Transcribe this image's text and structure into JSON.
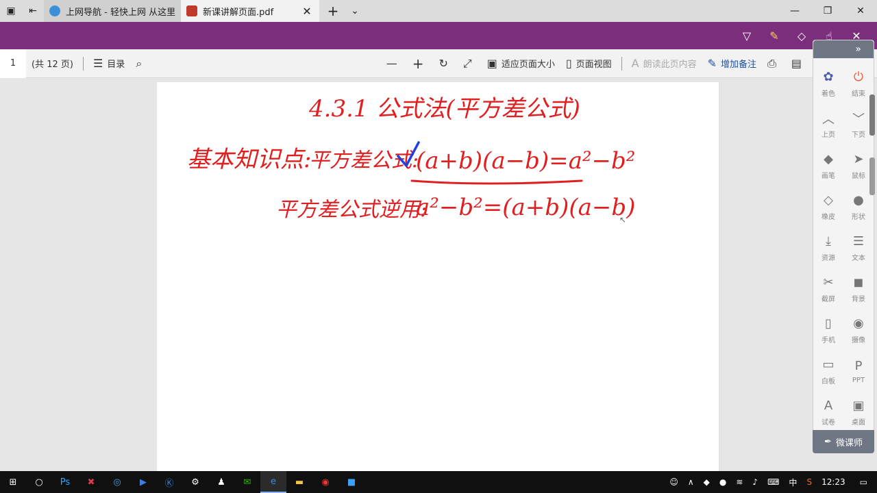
{
  "browser": {
    "tabs": [
      {
        "title": "上网导航 - 轻快上网 从这里",
        "active": false
      },
      {
        "title": "新课讲解页面.pdf",
        "active": true
      }
    ],
    "new_tab": "+",
    "tab_list": "⌄"
  },
  "ink_toolbar": {
    "tools": [
      "ballpoint-pen-icon",
      "highlighter-icon",
      "eraser-icon",
      "touch-write-icon",
      "close-icon"
    ]
  },
  "pdf_toolbar": {
    "page_number": "1",
    "page_total": "(共 12 页)",
    "contents_label": "目录",
    "fit_page_label": "适应页面大小",
    "page_view_label": "页面视图",
    "read_aloud_label": "朗读此页内容",
    "add_notes_label": "增加备注"
  },
  "page_content": {
    "title": "4.3.1 公式法(平方差公式)",
    "line1_label": "基本知识点:",
    "line1_sub": "平方差公式:",
    "line1_formula": "(a+b)(a−b)=a²−b²",
    "line2_label": "平方差公式逆用:",
    "line2_formula": "a²−b²=(a+b)(a−b)",
    "ink_color": "#e02020",
    "check_color": "#2040e0"
  },
  "side_panel": {
    "items": [
      {
        "icon": "palette-icon",
        "label": "着色"
      },
      {
        "icon": "power-icon",
        "label": "结束"
      },
      {
        "icon": "chevron-up-icon",
        "label": "上页"
      },
      {
        "icon": "chevron-down-icon",
        "label": "下页"
      },
      {
        "icon": "pen-icon",
        "label": "画笔"
      },
      {
        "icon": "mouse-pointer-icon",
        "label": "鼠标"
      },
      {
        "icon": "eraser-icon",
        "label": "橡皮"
      },
      {
        "icon": "shape-icon",
        "label": "形状"
      },
      {
        "icon": "download-icon",
        "label": "资源"
      },
      {
        "icon": "document-icon",
        "label": "文本"
      },
      {
        "icon": "scissors-icon",
        "label": "截屏"
      },
      {
        "icon": "layers-icon",
        "label": "背景"
      },
      {
        "icon": "phone-icon",
        "label": "手机"
      },
      {
        "icon": "camera-icon",
        "label": "摄像"
      },
      {
        "icon": "whiteboard-icon",
        "label": "白板"
      },
      {
        "icon": "ppt-icon",
        "label": "PPT"
      },
      {
        "icon": "quiz-icon",
        "label": "试卷"
      },
      {
        "icon": "desktop-icon",
        "label": "桌面"
      }
    ],
    "footer_label": "微课师"
  },
  "taskbar": {
    "apps": [
      "windows-icon",
      "search-icon",
      "photoshop-icon",
      "xmind-icon",
      "browser-icon",
      "media-player-icon",
      "k-app-icon",
      "network-icon",
      "qq-icon",
      "wechat-icon",
      "edge-icon",
      "file-explorer-icon",
      "music-icon",
      "teach-app-icon"
    ],
    "ime": "中",
    "time": "12:23"
  }
}
